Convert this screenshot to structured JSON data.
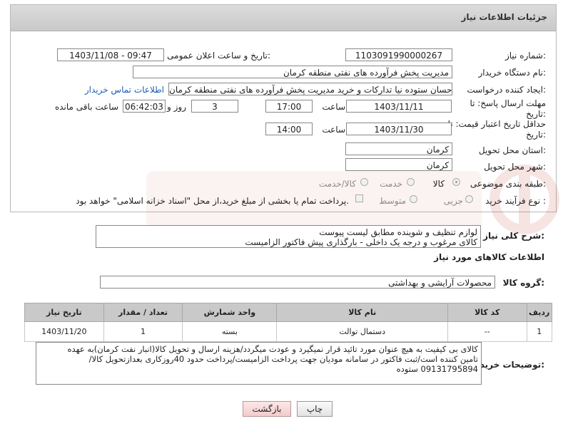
{
  "panel": {
    "title": "جزئیات اطلاعات نیاز"
  },
  "fields": {
    "need_number_label": "شماره نیاز:",
    "need_number": "1103091990000267",
    "announce_label": "تاریخ و ساعت اعلان عمومی:",
    "announce_value": "1403/11/08 - 09:47",
    "buyer_label": "نام دستگاه خریدار:",
    "buyer_value": "مدیریت پخش فرآورده های نفتی منطقه کرمان",
    "creator_label": "ایجاد کننده درخواست:",
    "creator_value": "احسان  ستوده نیا  تدارکات و خرید  مدیریت پخش فرآورده های نفتی منطقه کرمان",
    "contact_link": "اطلاعات تماس خریدار",
    "deadline_label_1": "مهلت ارسال پاسخ: تا",
    "deadline_label_2": "تاریخ:",
    "deadline_date": "1403/11/11",
    "time_label": "ساعت",
    "deadline_time": "17:00",
    "days_value": "3",
    "days_label": "روز و",
    "remaining_value": "06:42:03",
    "remaining_label": "ساعت باقی مانده",
    "validity_label_1": "حداقل تاریخ اعتبار قیمت: تا",
    "validity_label_2": "تاریخ:",
    "validity_date": "1403/11/30",
    "validity_time_label": "ساعت",
    "validity_time": "14:00",
    "province_label": "استان محل تحویل:",
    "province_value": "کرمان",
    "city_label": "شهر محل تحویل:",
    "city_value": "کرمان",
    "category_label": "طبقه بندی موضوعی:",
    "category_options": [
      "کالا",
      "خدمت",
      "کالا/خدمت"
    ],
    "process_label": "نوع فرآیند خرید :",
    "process_options": [
      "جزیی",
      "متوسط"
    ],
    "payment_note": "پرداخت تمام یا بخشی از مبلغ خرید،از محل \"اسناد خزانه اسلامی\" خواهد بود."
  },
  "summary": {
    "label": "شرح کلی نیاز:",
    "line1": "لوازم تنظیف و شوینده مطابق لیست پیوست",
    "line2": "کالای مرغوب و درجه یک داخلی - بارگذاری پیش فاکتور الزامیست"
  },
  "items_section": {
    "title": "اطلاعات کالاهای مورد نیاز",
    "group_label": "گروه کالا:",
    "group_value": "محصولات آرایشی و بهداشتی",
    "columns": [
      "ردیف",
      "کد کالا",
      "نام کالا",
      "واحد شمارش",
      "تعداد / مقدار",
      "تاریخ نیاز"
    ],
    "rows": [
      {
        "row": "1",
        "code": "--",
        "name": "دستمال توالت",
        "unit": "بسته",
        "qty": "1",
        "date": "1403/11/20"
      }
    ]
  },
  "buyer_notes": {
    "label": "توضیحات خریدار:",
    "line1": "کالای بی کیفیت به هیچ عنوان مورد تائید قرار نمیگیرد و عودت میگردد/هزینه ارسال و تحویل کالا(انبار نفت کرمان)به عهده",
    "line2": "تامین کننده است/ثبت فاکتور در سامانه مودیان جهت پرداخت الزامیست/پرداخت حدود 40روزکاری بعدازتحویل کالا/",
    "line3": "09131795894 ستوده"
  },
  "buttons": {
    "print": "چاپ",
    "back": "بازگشت"
  },
  "colors": {
    "header_bg": "#c9c9c9",
    "link": "#1a5fb4",
    "back_button": "#f3cccc"
  }
}
